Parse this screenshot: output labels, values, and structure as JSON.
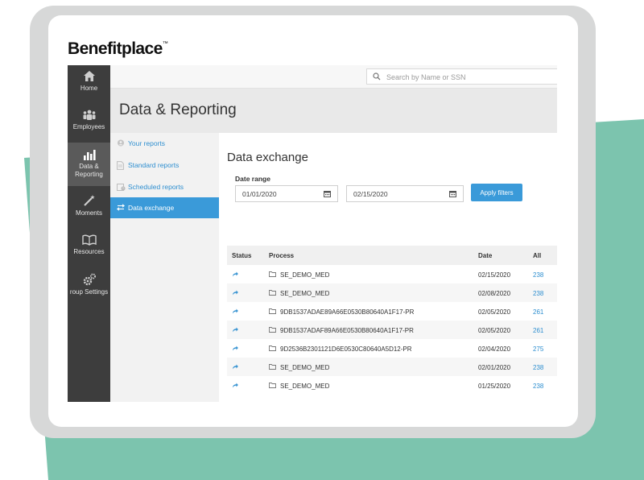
{
  "brand": {
    "name": "Benefitplace",
    "mark": "™"
  },
  "nav": {
    "items": [
      {
        "label": "Home",
        "icon": "home-icon"
      },
      {
        "label": "Employees",
        "icon": "employees-icon"
      },
      {
        "label": "Data &",
        "label2": "Reporting",
        "icon": "bar-chart-icon",
        "active": true
      },
      {
        "label": "Moments",
        "icon": "magic-wand-icon"
      },
      {
        "label": "Resources",
        "icon": "book-icon"
      },
      {
        "label": "roup Settings",
        "icon": "gears-icon"
      }
    ]
  },
  "search": {
    "placeholder": "Search by Name or SSN"
  },
  "page": {
    "title": "Data & Reporting"
  },
  "subnav": {
    "items": [
      {
        "label": "Your reports",
        "icon": "user-report-icon"
      },
      {
        "label": "Standard reports",
        "icon": "document-icon"
      },
      {
        "label": "Scheduled reports",
        "icon": "schedule-icon"
      },
      {
        "label": "Data exchange",
        "icon": "exchange-icon",
        "active": true
      }
    ]
  },
  "section": {
    "title": "Data exchange",
    "date_range_label": "Date range",
    "date_from": "01/01/2020",
    "date_to": "02/15/2020",
    "apply_label": "Apply filters"
  },
  "table": {
    "headers": {
      "status": "Status",
      "process": "Process",
      "date": "Date",
      "all": "All"
    },
    "rows": [
      {
        "process": "SE_DEMO_MED",
        "date": "02/15/2020",
        "all": "238"
      },
      {
        "process": "SE_DEMO_MED",
        "date": "02/08/2020",
        "all": "238"
      },
      {
        "process": "9DB1537ADAE89A66E0530B80640A1F17-PR",
        "date": "02/05/2020",
        "all": "261"
      },
      {
        "process": "9DB1537ADAF89A66E0530B80640A1F17-PR",
        "date": "02/05/2020",
        "all": "261"
      },
      {
        "process": "9D2536B2301121D6E0530C80640A5D12-PR",
        "date": "02/04/2020",
        "all": "275"
      },
      {
        "process": "SE_DEMO_MED",
        "date": "02/01/2020",
        "all": "238"
      },
      {
        "process": "SE_DEMO_MED",
        "date": "01/25/2020",
        "all": "238"
      }
    ]
  },
  "colors": {
    "accent": "#3a9ad9",
    "link": "#2f8fd0",
    "nav_bg": "#3d3d3d",
    "teal": "#7cc4ae"
  }
}
